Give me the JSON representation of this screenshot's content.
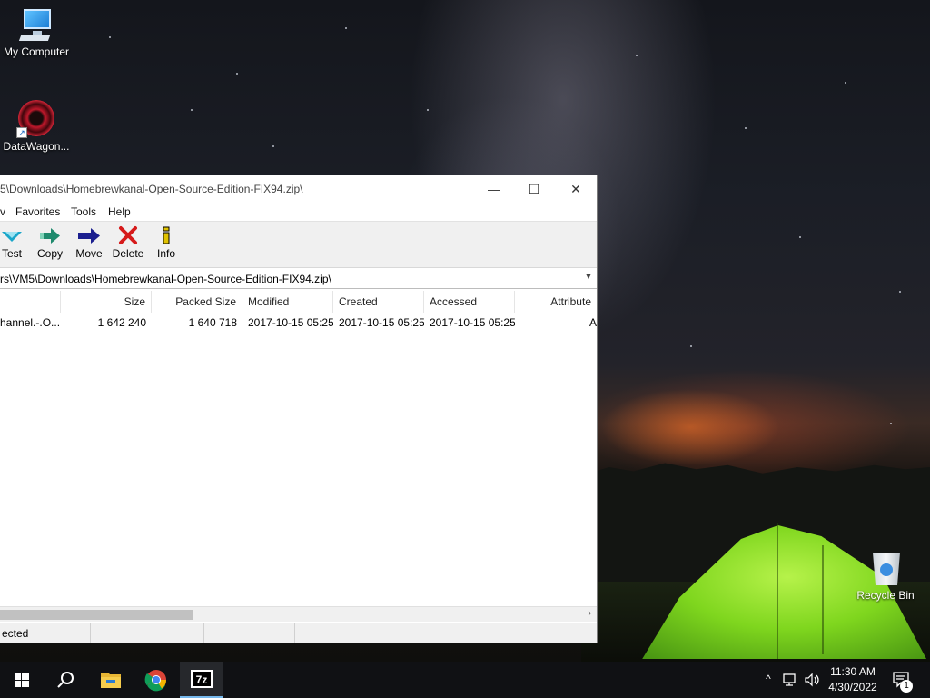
{
  "desktop": {
    "icons": [
      {
        "label": "My Computer"
      },
      {
        "label": "DataWagon..."
      },
      {
        "label": "Recycle Bin"
      }
    ]
  },
  "window": {
    "title": "5\\Downloads\\Homebrewkanal-Open-Source-Edition-FIX94.zip\\",
    "controls": {
      "minimize": "—",
      "maximize": "☐",
      "close": "✕"
    },
    "menu": [
      "v",
      "Favorites",
      "Tools",
      "Help"
    ],
    "toolbar": [
      {
        "label": "Test",
        "icon": "test-icon",
        "color": "#1aa6c9"
      },
      {
        "label": "Copy",
        "icon": "copy-icon",
        "color": "#1f8a6d"
      },
      {
        "label": "Move",
        "icon": "move-icon",
        "color": "#1b1f8f"
      },
      {
        "label": "Delete",
        "icon": "delete-icon",
        "color": "#d61a1a"
      },
      {
        "label": "Info",
        "icon": "info-icon",
        "color": "#e0c200"
      }
    ],
    "address": "rs\\VM5\\Downloads\\Homebrewkanal-Open-Source-Edition-FIX94.zip\\",
    "columns": [
      "",
      "Size",
      "Packed Size",
      "Modified",
      "Created",
      "Accessed",
      "Attribute"
    ],
    "rows": [
      {
        "name": "hannel.-.O...",
        "size": "1 642 240",
        "packed": "1 640 718",
        "modified": "2017-10-15 05:25",
        "created": "2017-10-15 05:25",
        "accessed": "2017-10-15 05:25",
        "attr": "A"
      }
    ],
    "status": "ected"
  },
  "taskbar": {
    "time": "11:30 AM",
    "date": "4/30/2022",
    "notification_count": "1",
    "pinned": [
      "start",
      "search",
      "file-explorer",
      "chrome",
      "7zip"
    ],
    "seven_zip_label": "7z"
  }
}
